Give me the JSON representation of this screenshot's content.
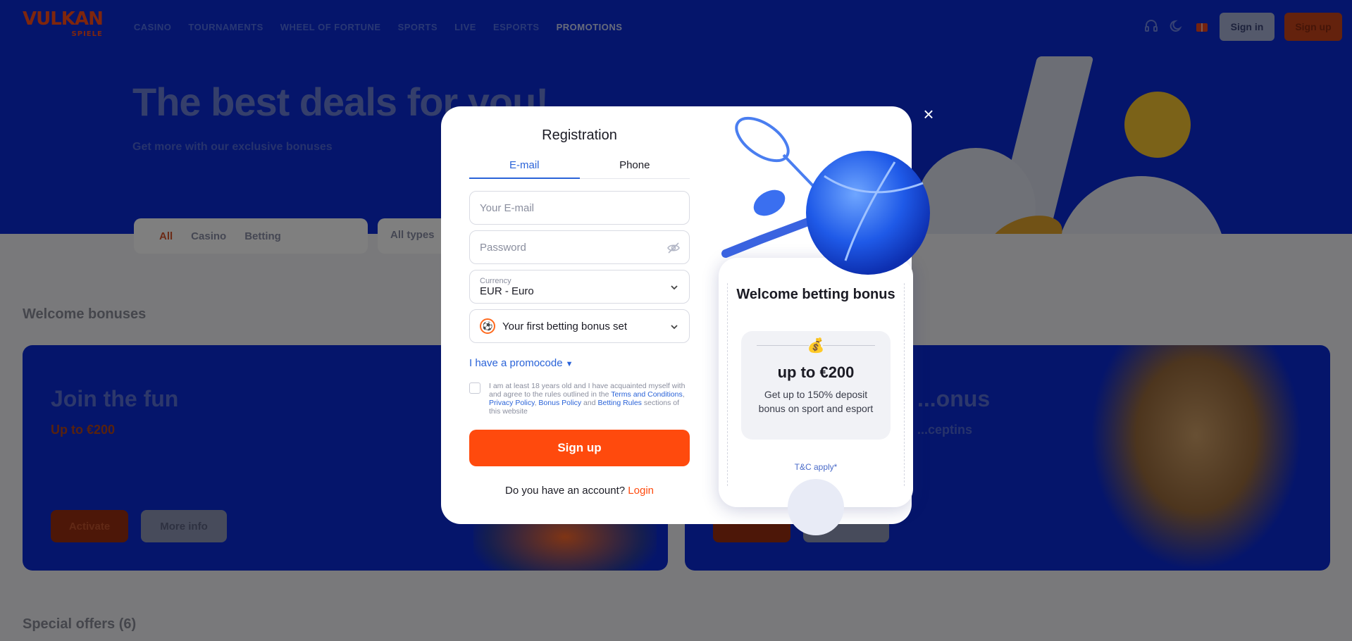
{
  "header": {
    "logo_main": "VULKAN",
    "logo_sub": "SPIELE",
    "nav": [
      "CASINO",
      "TOURNAMENTS",
      "WHEEL OF FORTUNE",
      "SPORTS",
      "LIVE",
      "ESPORTS",
      "PROMOTIONS"
    ],
    "nav_active": "PROMOTIONS",
    "signin_label": "Sign in",
    "signup_label": "Sign up"
  },
  "hero": {
    "title": "The best deals for you!",
    "subtitle": "Get more with our exclusive bonuses"
  },
  "filters": {
    "items": [
      "All",
      "Casino",
      "Betting"
    ],
    "active": "All",
    "types_label": "All types"
  },
  "sections": {
    "welcome_title": "Welcome bonuses",
    "special_title": "Special offers (6)"
  },
  "cards": {
    "left": {
      "title": "Join the fun",
      "subtitle": "Up to €200",
      "activate": "Activate",
      "more": "More info"
    },
    "right": {
      "title": "...onus",
      "subtitle": "...ceptins",
      "activate": "",
      "more": ""
    }
  },
  "modal": {
    "title": "Registration",
    "tabs": [
      "E-mail",
      "Phone"
    ],
    "active_tab": "E-mail",
    "email_placeholder": "Your E-mail",
    "password_placeholder": "Password",
    "currency_label": "Currency",
    "currency_value": "EUR - Euro",
    "bonus_value": "Your first betting bonus set",
    "promocode_label": "I have a promocode",
    "terms_prefix": "I am at least 18 years old and I have acquainted myself with and agree to the rules outlined in the ",
    "terms_link1": "Terms and Conditions",
    "terms_sep1": ", ",
    "terms_link2": "Privacy Policy",
    "terms_sep2": ", ",
    "terms_link3": "Bonus Policy",
    "terms_and": " and ",
    "terms_link4": "Betting Rules",
    "terms_suffix": " sections of this website",
    "signup_button": "Sign up",
    "have_account": "Do you have an account?",
    "login_link": "Login",
    "close_icon": "×"
  },
  "promo": {
    "title": "Welcome betting bonus",
    "bag_icon": "💰",
    "amount": "up to €200",
    "description": "Get up to 150% deposit bonus on sport and esport",
    "tc": "T&C apply*"
  },
  "colors": {
    "brand_orange": "#ff4a0d",
    "link_blue": "#2a63d8",
    "hero_blue": "#0b2bd6"
  }
}
